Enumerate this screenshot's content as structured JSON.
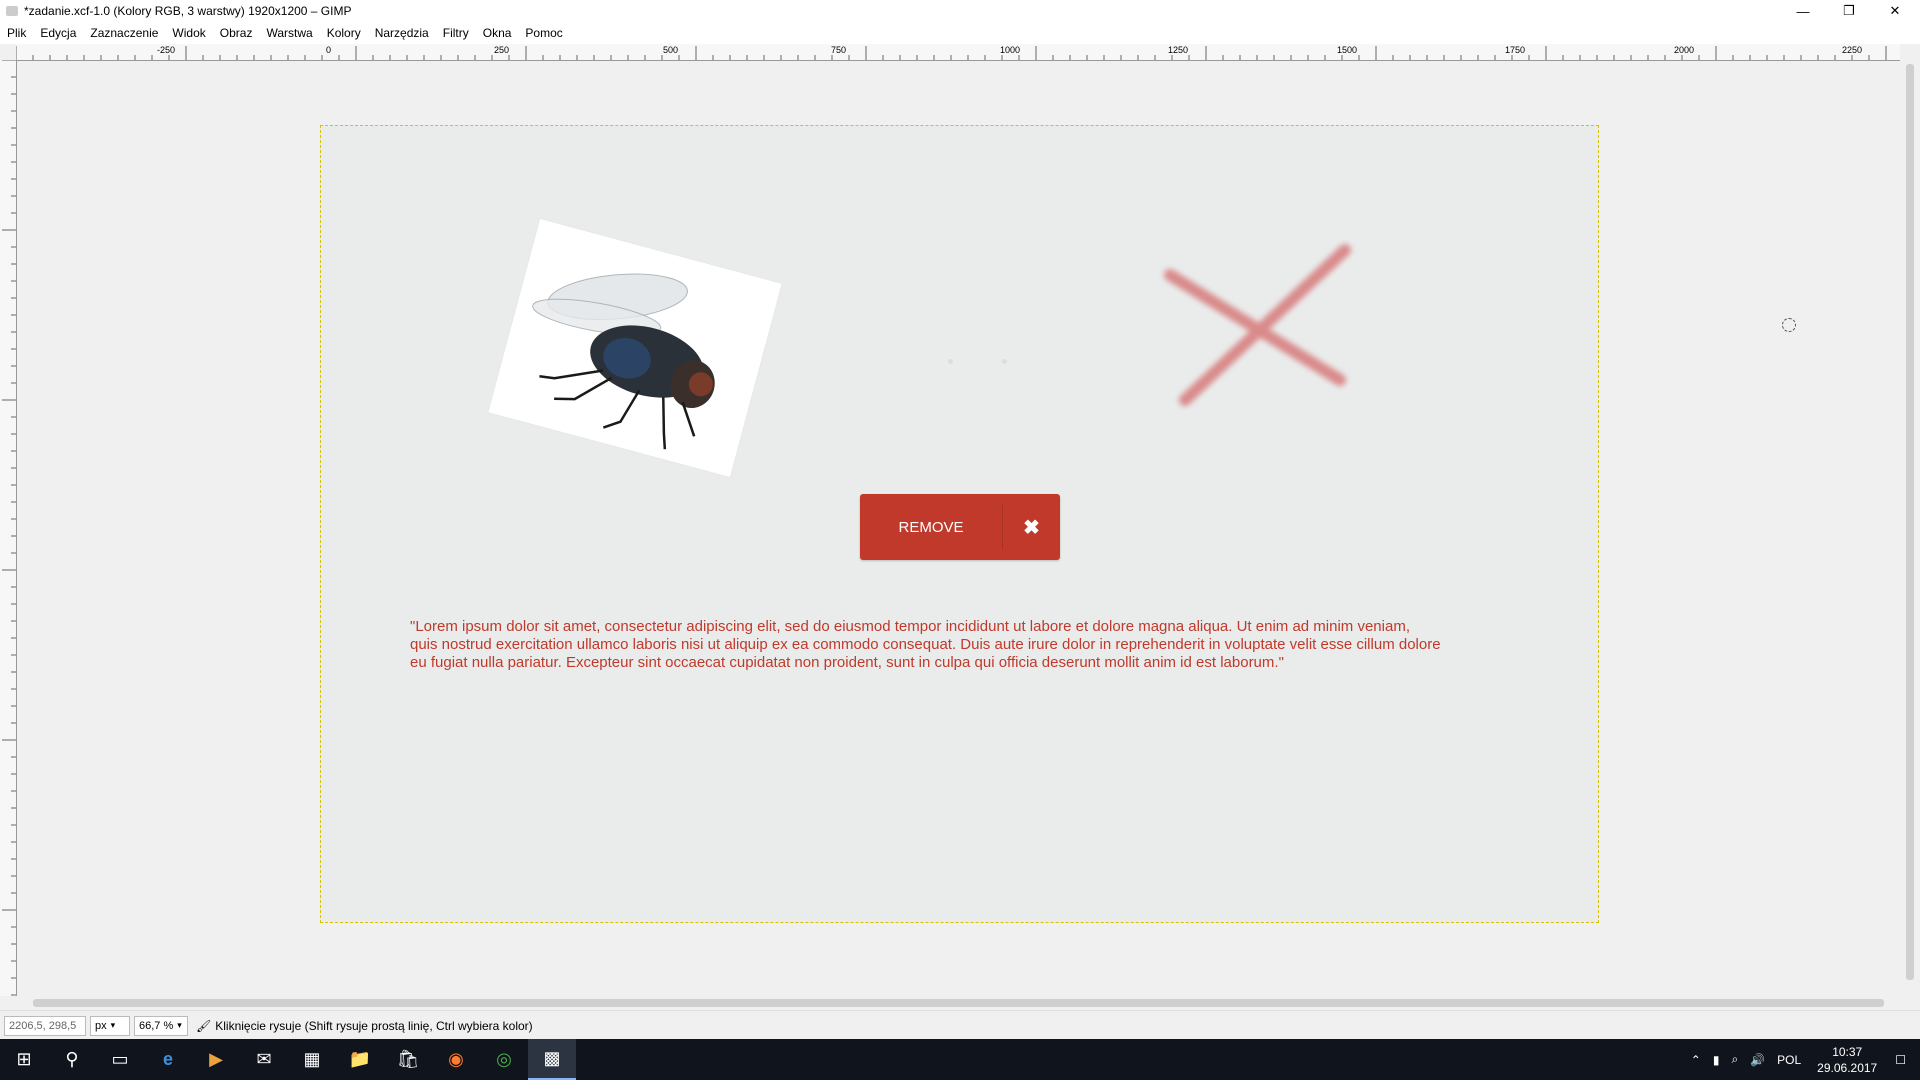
{
  "window": {
    "title": "*zadanie.xcf-1.0 (Kolory RGB, 3 warstwy) 1920x1200 – GIMP"
  },
  "menu": [
    "Plik",
    "Edycja",
    "Zaznaczenie",
    "Widok",
    "Obraz",
    "Warstwa",
    "Kolory",
    "Narzędzia",
    "Filtry",
    "Okna",
    "Pomoc"
  ],
  "ruler": {
    "h_ticks": [
      "-250",
      "0",
      "250",
      "500",
      "750",
      "1000",
      "1250",
      "1500",
      "1750",
      "2000",
      "2250"
    ]
  },
  "canvas": {
    "button_label": "REMOVE",
    "button_icon": "✖",
    "lorem": "\"Lorem ipsum dolor sit amet, consectetur adipiscing elit, sed do eiusmod tempor incididunt ut labore et dolore magna aliqua. Ut enim ad minim veniam,\nquis nostrud exercitation ullamco laboris nisi ut aliquip ex ea commodo consequat. Duis aute irure dolor in reprehenderit in voluptate velit esse cillum dolore\n eu fugiat nulla pariatur. Excepteur sint occaecat cupidatat non proident, sunt in culpa qui officia deserunt mollit anim id est laborum.\""
  },
  "status": {
    "coords": "2206,5, 298,5",
    "unit": "px",
    "zoom": "66,7 %",
    "message": "Kliknięcie rysuje (Shift rysuje prostą linię, Ctrl wybiera kolor)"
  },
  "taskbar": {
    "lang": "POL",
    "time": "10:37",
    "date": "29.06.2017"
  },
  "colors": {
    "accent_red": "#c0392b",
    "canvas_bg": "#eaecec",
    "selection": "#d8c200"
  }
}
